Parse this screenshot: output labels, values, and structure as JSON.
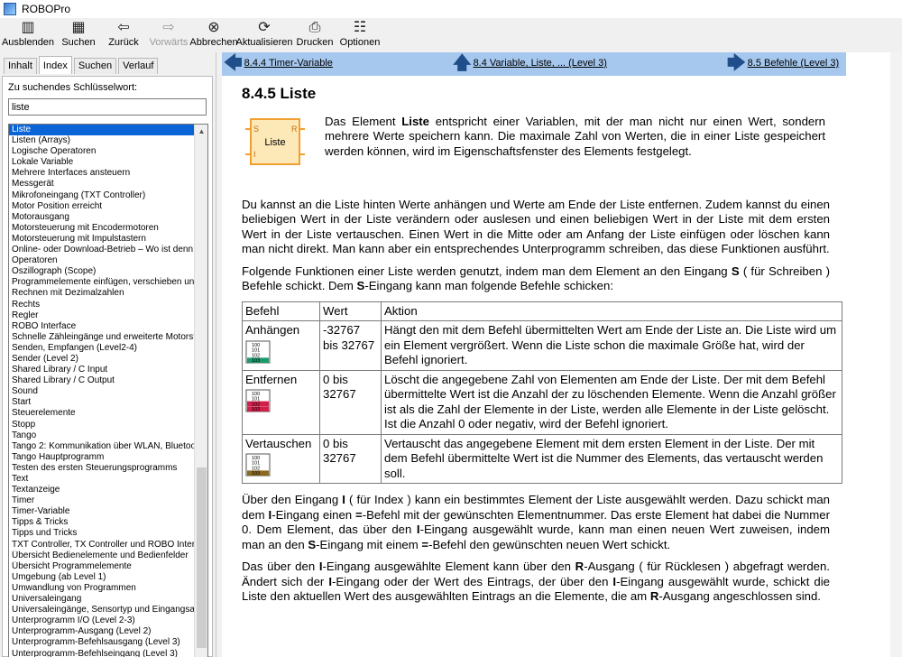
{
  "window": {
    "title": "ROBOPro"
  },
  "toolbar": {
    "buttons": [
      {
        "name": "hide",
        "label": "Ausblenden",
        "icon": "hide-icon",
        "glyph": "▥"
      },
      {
        "name": "search",
        "label": "Suchen",
        "icon": "search-icon",
        "glyph": "▦"
      },
      {
        "name": "back",
        "label": "Zurück",
        "icon": "back-arrow-icon",
        "glyph": "⇦"
      },
      {
        "name": "forward",
        "label": "Vorwärts",
        "icon": "forward-arrow-icon",
        "glyph": "⇨",
        "disabled": true
      },
      {
        "name": "stop",
        "label": "Abbrechen",
        "icon": "stop-icon",
        "glyph": "⊗"
      },
      {
        "name": "refresh",
        "label": "Aktualisieren",
        "icon": "refresh-icon",
        "glyph": "⟳"
      },
      {
        "name": "print",
        "label": "Drucken",
        "icon": "print-icon",
        "glyph": "⎙"
      },
      {
        "name": "options",
        "label": "Optionen",
        "icon": "options-icon",
        "glyph": "☷"
      }
    ]
  },
  "left": {
    "tabs": [
      "Inhalt",
      "Index",
      "Suchen",
      "Verlauf"
    ],
    "active_tab": "Index",
    "keyword_label": "Zu suchendes Schlüsselwort:",
    "keyword_value": "liste",
    "items": [
      "Liste",
      "Listen (Arrays)",
      "Logische Operatoren",
      "Lokale Variable",
      "Mehrere Interfaces ansteuern",
      "Messgerät",
      "Mikrofoneingang (TXT Controller)",
      "Motor Position erreicht",
      "Motorausgang",
      "Motorsteuerung mit Encodermotoren",
      "Motorsteuerung mit Impulstastern",
      "Online- oder Download-Betrieb – Wo ist denn",
      "Operatoren",
      "Oszillograph (Scope)",
      "Programmelemente einfügen, verschieben und",
      "Rechnen mit Dezimalzahlen",
      "Rechts",
      "Regler",
      "ROBO Interface",
      "Schnelle Zähleingänge und erweiterte Motorst",
      "Senden, Empfangen (Level2-4)",
      "Sender (Level 2)",
      "Shared Library / C Input",
      "Shared Library / C Output",
      "Sound",
      "Start",
      "Steuerelemente",
      "Stopp",
      "Tango",
      "Tango 2: Kommunikation über WLAN, Bluetoo",
      "Tango Hauptprogramm",
      "Testen des ersten Steuerungsprogramms",
      "Text",
      "Textanzeige",
      "Timer",
      "Timer-Variable",
      "Tipps & Tricks",
      "Tipps und Tricks",
      "TXT Controller, TX Controller und ROBO Interf",
      "Übersicht Bedienelemente und Bedienfelder",
      "Übersicht Programmelemente",
      "Umgebung (ab Level 1)",
      "Umwandlung von Programmen",
      "Universaleingang",
      "Universaleingänge, Sensortyp und Eingangsa",
      "Unterprogramm I/O (Level 2-3)",
      "Unterprogramm-Ausgang (Level 2)",
      "Unterprogramm-Befehlsausgang (Level 3)",
      "Unterprogramm-Befehlseingang (Level 3)"
    ]
  },
  "nav": {
    "prev": "8.4.4  Timer-Variable",
    "up": "8.4  Variable, Liste, ... (Level 3)",
    "next": "8.5  Befehle (Level 3)"
  },
  "doc": {
    "title": "8.4.5  Liste",
    "icon_label": "Liste",
    "icon_s": "S",
    "icon_r": "R",
    "icon_i": "I",
    "intro_pre": "Das Element ",
    "intro_bold": "Liste",
    "intro_post": " entspricht einer Variablen, mit der man nicht nur einen Wert, sondern mehrere Werte speichern kann. Die maximale Zahl von Werten, die in einer Liste gespeichert werden können, wird im Eigenschaftsfenster des Elements festgelegt.",
    "para1": "Du kannst an die Liste hinten Werte anhängen und Werte am Ende der Liste entfernen. Zudem kannst du einen beliebigen Wert in der Liste verändern oder auslesen und einen beliebigen Wert in der Liste mit dem ersten Wert in der Liste vertauschen. Einen Wert in die Mitte oder am Anfang der Liste einfügen oder löschen kann man nicht direkt. Man kann aber ein entsprechendes Unterprogramm schreiben, das diese Funktionen ausführt.",
    "para2_a": "Folgende Funktionen einer Liste werden genutzt, indem man dem Element an den Eingang ",
    "para2_b": "S",
    "para2_c": " ( für Schreiben ) Befehle schickt. Dem ",
    "para2_d": "S",
    "para2_e": "-Eingang kann man folgende Befehle schicken:",
    "table": {
      "headers": [
        "Befehl",
        "Wert",
        "Aktion"
      ],
      "rows": [
        {
          "cmd": "Anhängen",
          "value": "-32767 bis 32767",
          "action": "Hängt den mit dem Befehl übermittelten Wert am Ende der Liste an. Die Liste wird um ein Element vergrößert. Wenn die Liste schon die maximale Größe hat, wird der Befehl ignoriert.",
          "icon": "append-list-icon",
          "accent": "#1a9a6a",
          "n1": "100",
          "n2": "101",
          "n3": "102",
          "n4": "103"
        },
        {
          "cmd": "Entfernen",
          "value": "0 bis 32767",
          "action": "Löscht die angegebene Zahl von Elementen am Ende der Liste. Der mit dem Befehl übermittelte Wert ist die Anzahl der zu löschenden Elemente. Wenn die Anzahl größer ist als die Zahl der Elemente in der Liste, werden alle Elemente in der Liste gelöscht. Ist die Anzahl 0 oder negativ, wird der Befehl ignoriert.",
          "icon": "remove-list-icon",
          "accent": "#d0204a",
          "n1": "100",
          "n2": "101",
          "n3": "102",
          "n4": "103"
        },
        {
          "cmd": "Vertauschen",
          "value": "0 bis 32767",
          "action": "Vertauscht das angegebene Element mit dem ersten Element in der Liste. Der mit dem Befehl übermittelte Wert ist die Nummer des Elements, das vertauscht werden soll.",
          "icon": "swap-list-icon",
          "accent": "#8a6a20",
          "n1": "100",
          "n2": "101",
          "n3": "102",
          "n4": "103"
        }
      ]
    },
    "para3_a": "Über den Eingang ",
    "para3_b": "I",
    "para3_c": " ( für Index ) kann ein bestimmtes Element der Liste ausgewählt werden. Dazu schickt man dem ",
    "para3_d": "I",
    "para3_e": "-Eingang einen ",
    "para3_f": "=",
    "para3_g": "-Befehl mit der gewünschten Elementnummer. Das erste Element hat dabei die Nummer 0. Dem Element, das über den ",
    "para3_h": "I",
    "para3_i": "-Eingang ausgewählt wurde, kann man einen neuen Wert zuweisen, indem man an den ",
    "para3_j": "S",
    "para3_k": "-Eingang mit einem ",
    "para3_l": "=",
    "para3_m": "-Befehl den gewünschten neuen Wert schickt.",
    "para4_a": "Das über den ",
    "para4_b": "I",
    "para4_c": "-Eingang ausgewählte Element kann über den ",
    "para4_d": "R",
    "para4_e": "-Ausgang ( für Rücklesen ) abgefragt werden. Ändert sich der ",
    "para4_f": "I",
    "para4_g": "-Eingang oder der Wert des Eintrags, der über den ",
    "para4_h": "I",
    "para4_i": "-Eingang ausgewählt wurde, schickt die Liste den aktuellen Wert des ausgewählten Eintrags an die Elemente, die am ",
    "para4_j": "R",
    "para4_k": "-Ausgang angeschlossen sind."
  },
  "colors": {
    "nav_bg": "#a6c8ee",
    "selection": "#0a64d8",
    "icon_orange": "#f0a030",
    "icon_fill": "#fde8b8"
  }
}
